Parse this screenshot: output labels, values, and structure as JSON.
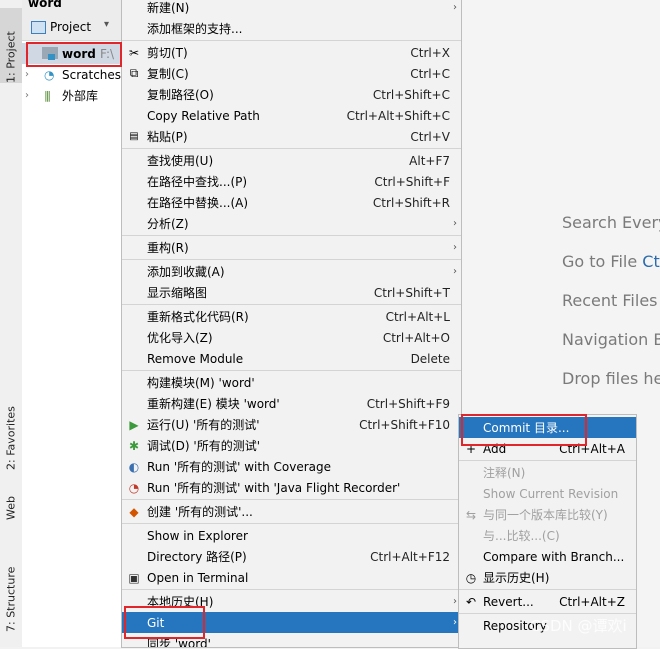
{
  "left_tabs": {
    "project": "1: Project",
    "favorites": "2: Favorites",
    "web": "Web",
    "structure": "7: Structure"
  },
  "project_panel": {
    "window_title": "word",
    "header_label": "Project",
    "tree": [
      {
        "label": "word",
        "suffix": "F:\\"
      },
      {
        "label": "Scratches"
      },
      {
        "label": "外部库"
      }
    ]
  },
  "welcome_hints": [
    {
      "text": "Search Every",
      "key": ""
    },
    {
      "text": "Go to File ",
      "key": "Ctr"
    },
    {
      "text": "Recent Files ",
      "key": "C"
    },
    {
      "text": "Navigation B",
      "key": ""
    },
    {
      "text": "Drop files he",
      "key": ""
    }
  ],
  "context_menu": {
    "items": [
      {
        "label": "新建(N)",
        "shortcut": "",
        "arrow": true
      },
      {
        "label": "添加框架的支持...",
        "shortcut": ""
      },
      {
        "label": "剪切(T)",
        "shortcut": "Ctrl+X",
        "icon": "✂"
      },
      {
        "label": "复制(C)",
        "shortcut": "Ctrl+C",
        "icon": "⧉"
      },
      {
        "label": "复制路径(O)",
        "shortcut": "Ctrl+Shift+C"
      },
      {
        "label": "Copy Relative Path",
        "shortcut": "Ctrl+Alt+Shift+C"
      },
      {
        "label": "粘贴(P)",
        "shortcut": "Ctrl+V",
        "icon": "📋"
      },
      {
        "label": "查找使用(U)",
        "shortcut": "Alt+F7"
      },
      {
        "label": "在路径中查找...(P)",
        "shortcut": "Ctrl+Shift+F"
      },
      {
        "label": "在路径中替换...(A)",
        "shortcut": "Ctrl+Shift+R"
      },
      {
        "label": "分析(Z)",
        "shortcut": "",
        "arrow": true
      },
      {
        "label": "重构(R)",
        "shortcut": "",
        "arrow": true
      },
      {
        "label": "添加到收藏(A)",
        "shortcut": "",
        "arrow": true
      },
      {
        "label": "显示缩略图",
        "shortcut": "Ctrl+Shift+T"
      },
      {
        "label": "重新格式化代码(R)",
        "shortcut": "Ctrl+Alt+L"
      },
      {
        "label": "优化导入(Z)",
        "shortcut": "Ctrl+Alt+O"
      },
      {
        "label": "Remove Module",
        "shortcut": "Delete"
      },
      {
        "label": "构建模块(M) 'word'",
        "shortcut": ""
      },
      {
        "label": "重新构建(E) 模块 'word'",
        "shortcut": "Ctrl+Shift+F9"
      },
      {
        "label": "运行(U) '所有的测试'",
        "shortcut": "Ctrl+Shift+F10",
        "icon": "▶"
      },
      {
        "label": "调试(D) '所有的测试'",
        "shortcut": "",
        "icon": "✱"
      },
      {
        "label": "Run '所有的测试' with Coverage",
        "shortcut": "",
        "icon": "◐"
      },
      {
        "label": "Run '所有的测试' with 'Java Flight Recorder'",
        "shortcut": "",
        "icon": "◔"
      },
      {
        "label": "创建 '所有的测试'...",
        "shortcut": "",
        "icon": "◆"
      },
      {
        "label": "Show in Explorer",
        "shortcut": ""
      },
      {
        "label": "Directory 路径(P)",
        "shortcut": "Ctrl+Alt+F12"
      },
      {
        "label": "Open in Terminal",
        "shortcut": "",
        "icon": "▣"
      },
      {
        "label": "本地历史(H)",
        "shortcut": "",
        "arrow": true
      },
      {
        "label": "Git",
        "shortcut": "",
        "arrow": true
      },
      {
        "label": "同步 'word'",
        "shortcut": ""
      }
    ]
  },
  "git_submenu": {
    "items": [
      {
        "label": "Commit 目录...",
        "shortcut": ""
      },
      {
        "label": "Add",
        "shortcut": "Ctrl+Alt+A",
        "icon": "+"
      },
      {
        "label": "注释(N)",
        "shortcut": ""
      },
      {
        "label": "Show Current Revision",
        "shortcut": ""
      },
      {
        "label": "与同一个版本库比较(Y)",
        "shortcut": "",
        "icon": "⇆"
      },
      {
        "label": "与...比较...(C)",
        "shortcut": ""
      },
      {
        "label": "Compare with Branch...",
        "shortcut": ""
      },
      {
        "label": "显示历史(H)",
        "shortcut": "",
        "icon": "◷"
      },
      {
        "label": "Revert...",
        "shortcut": "Ctrl+Alt+Z",
        "icon": "↶"
      },
      {
        "label": "Repository",
        "shortcut": ""
      }
    ]
  },
  "watermark": "CSDN @谭欢i",
  "colors": {
    "highlight": "#2675bf",
    "annotation": "#e0262a"
  }
}
